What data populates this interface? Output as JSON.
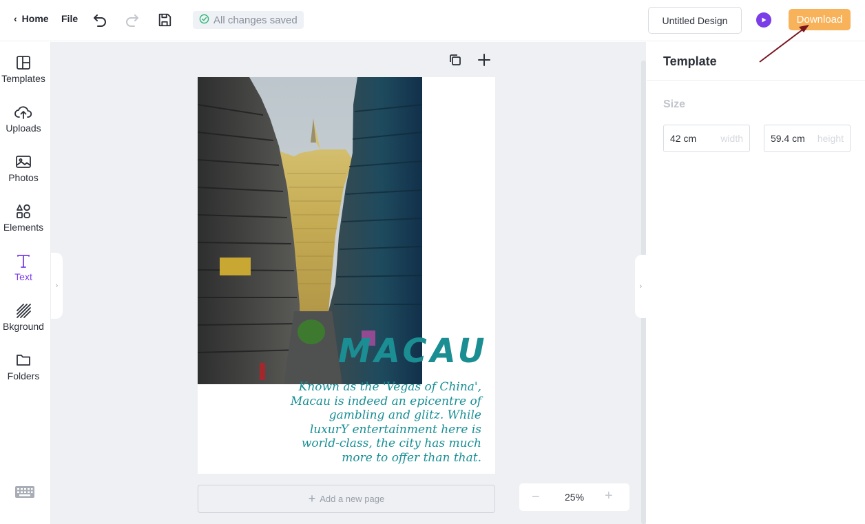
{
  "topbar": {
    "home_label": "Home",
    "file_label": "File",
    "save_status": "All changes saved",
    "design_title": "Untitled Design",
    "download_label": "Download"
  },
  "sidebar": {
    "items": [
      {
        "label": "Templates",
        "icon": "layout-icon"
      },
      {
        "label": "Uploads",
        "icon": "cloud-upload-icon"
      },
      {
        "label": "Photos",
        "icon": "image-icon"
      },
      {
        "label": "Elements",
        "icon": "shapes-icon"
      },
      {
        "label": "Text",
        "icon": "text-icon",
        "active": true
      },
      {
        "label": "Bkground",
        "icon": "hatch-icon"
      },
      {
        "label": "Folders",
        "icon": "folder-icon"
      }
    ]
  },
  "canvas": {
    "page": {
      "title": "MACAU",
      "body_lines": [
        "Known as the 'Vegas of China',",
        "Macau is indeed an epicentre of",
        "gambling and glitz. While",
        "luxurY entertainment here is",
        "world-class, the city has much",
        "more to offer than that."
      ]
    },
    "add_page_label": "Add a new page",
    "zoom": "25%"
  },
  "right_panel": {
    "title": "Template",
    "size_label": "Size",
    "width_value": "42 cm",
    "width_placeholder": "width",
    "height_value": "59.4 cm",
    "height_placeholder": "height"
  },
  "colors": {
    "accent": "#7a3de8",
    "download": "#f8b25a",
    "title_teal": "#1a8e92",
    "annotation_arrow": "#7a1520"
  }
}
